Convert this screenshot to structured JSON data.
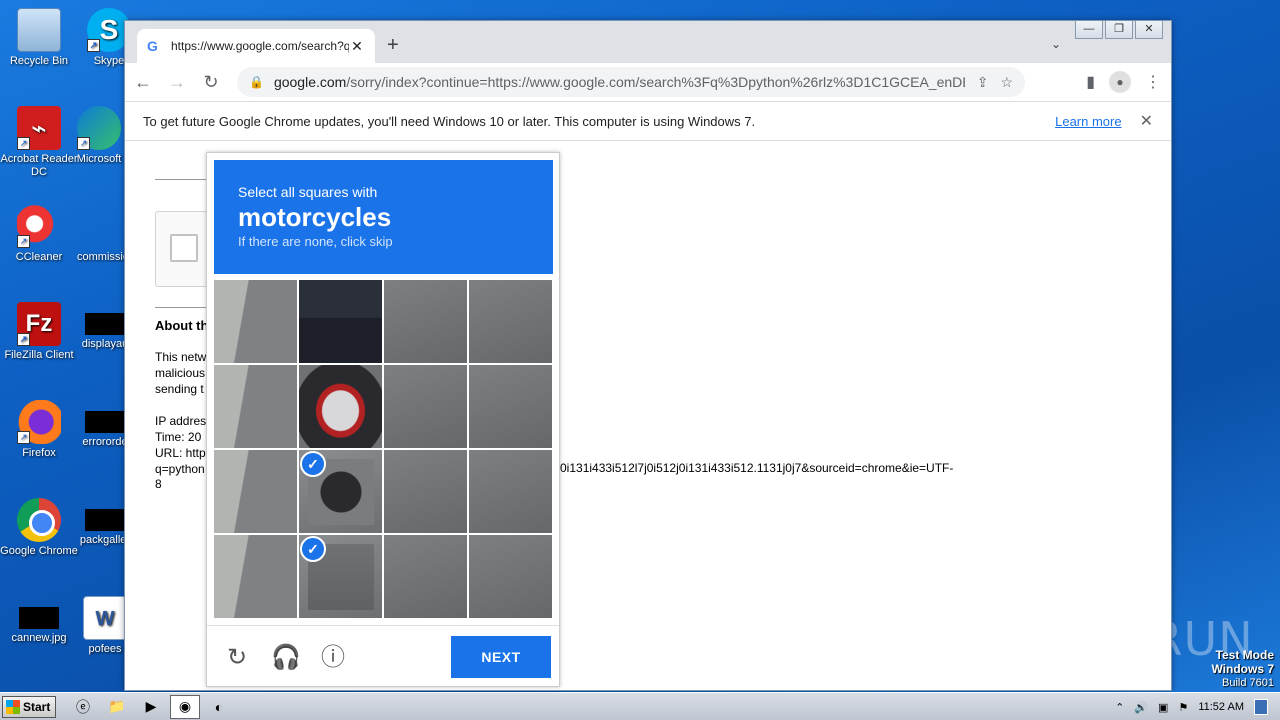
{
  "desktop": {
    "icons": [
      {
        "label": "Recycle Bin"
      },
      {
        "label": "Skype"
      },
      {
        "label": "Acrobat Reader DC"
      },
      {
        "label": "Microsoft"
      },
      {
        "label": "CCleaner"
      },
      {
        "label": "commissio"
      },
      {
        "label": "FileZilla Client"
      },
      {
        "label": "displayau"
      },
      {
        "label": "Firefox"
      },
      {
        "label": "errororde"
      },
      {
        "label": "Google Chrome"
      },
      {
        "label": "packgaller"
      },
      {
        "label": "cannew.jpg"
      },
      {
        "label": "pofees"
      }
    ],
    "watermark": "ANY RUN",
    "testmode": {
      "line1": "Test Mode",
      "line2": "Windows 7",
      "line3": "Build 7601"
    }
  },
  "browser": {
    "tab": {
      "favicon": "G",
      "title": "https://www.google.com/search?q="
    },
    "new_tab": "+",
    "tab_search": "⌄",
    "window_buttons": {
      "minimize": "—",
      "restore": "❐",
      "close": "✕"
    },
    "address": {
      "host": "google.com",
      "path": "/sorry/index?continue=https://www.google.com/search%3Fq%3Dpython%26rlz%3D1C1GCEA_enDE1..."
    },
    "infobar": {
      "message": "To get future Google Chrome updates, you'll need Windows 10 or later. This computer is using Windows 7.",
      "link": "Learn more"
    }
  },
  "page": {
    "about": "About th",
    "para": "This netw malicious sending t",
    "ip_label": "IP addres",
    "time_label": "Time: 20",
    "url_label": "URL: http",
    "q_line": "q=python",
    "url_tail": "0i131i433i512l7j0i512j0i131i433i512.1131j0j7&sourceid=chrome&ie=UTF-",
    "url_end": "8"
  },
  "captcha": {
    "instruction": "Select all squares with",
    "target": "motorcycles",
    "hint": "If there are none, click skip",
    "next_label": "NEXT",
    "selected_tiles": [
      9,
      13
    ]
  },
  "taskbar": {
    "start_label": "Start",
    "clock": "11:52 AM"
  }
}
